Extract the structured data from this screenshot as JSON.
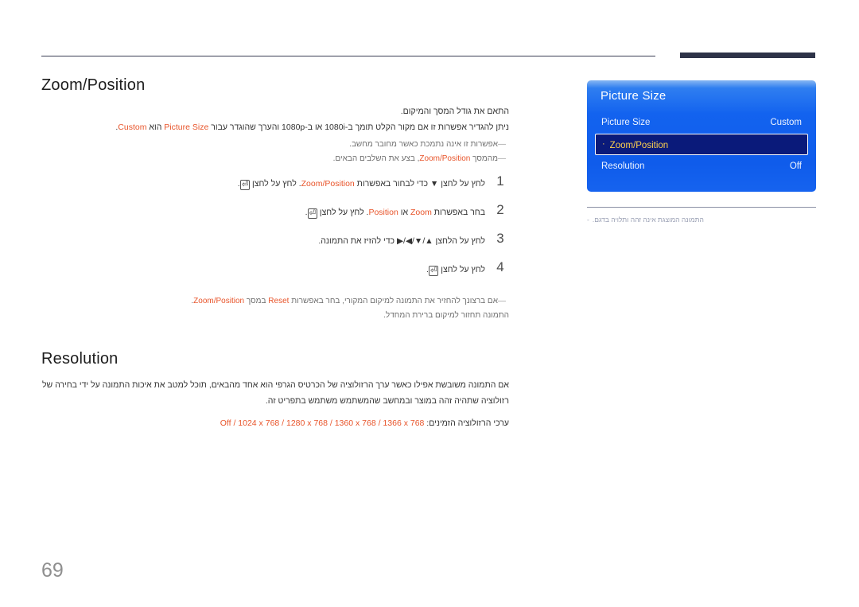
{
  "page": {
    "number": "69"
  },
  "sections": {
    "zoom_position": {
      "title": "Zoom/Position",
      "lead": "התאם את גודל המסך והמיקום.",
      "notes": [
        {
          "before": "ניתן להגדיר אפשרות זו אם מקור הקלט תומך ב-1080i או ב-1080p והערך שהוגדר עבור ",
          "term": "Picture Size",
          "middle": " הוא ",
          "term2": "Custom",
          "after": "."
        }
      ],
      "sub_notes": [
        "אפשרות זו אינה נתמכת כאשר מחובר מחשב.",
        "מהמסך Zoom/Position, בצע את השלבים הבאים."
      ],
      "sub_note_2_parts": {
        "before": "מהמסך ",
        "term": "Zoom/Position",
        "after": ", בצע את השלבים הבאים."
      },
      "steps": [
        {
          "num": "1",
          "before": "לחץ על לחצן ▼ כדי לבחור באפשרות ",
          "term": "Zoom/Position",
          "after": ". לחץ על לחצן ",
          "key": "⏎",
          "tail": "."
        },
        {
          "num": "2",
          "before": "בחר באפשרות ",
          "term": "Zoom",
          "middle": " או ",
          "term2": "Position",
          "after": ". לחץ על לחצן ",
          "key": "⏎",
          "tail": "."
        },
        {
          "num": "3",
          "text": "לחץ על הלחצן ▲/▼/◀/▶ כדי להזיז את התמונה."
        },
        {
          "num": "4",
          "before": "לחץ על לחצן ",
          "key": "⏎",
          "tail": "."
        }
      ],
      "post_note": {
        "line1_before": "אם ברצונך להחזיר את התמונה למיקום המקורי, בחר באפשרות ",
        "line1_term": "Reset",
        "line1_middle": " במסך ",
        "line1_term2": "Zoom/Position",
        "line1_after": ".",
        "line2": "התמונה תחזור למיקום ברירת המחדל."
      }
    },
    "resolution": {
      "title": "Resolution",
      "body_line1": "אם התמונה משובשת אפילו כאשר ערך הרזולוציה של הכרטיס הגרפי הוא אחד מהבאים, תוכל למטב את איכות התמונה על ידי בחירה של",
      "body_line2": "רזולוציה שתהיה זהה במוצר ובמחשב שהמשתמש משתמש בתפריט זה.",
      "values_label": "ערכי הרזולוציה הזמינים: ",
      "values": "Off / 1024 x 768 / 1280 x 768 / 1360 x 768 / 1366 x 768"
    }
  },
  "osd": {
    "title": "Picture Size",
    "rows": [
      {
        "label": "Picture Size",
        "value": "Custom",
        "selected": false,
        "bullet": ""
      },
      {
        "label": "Zoom/Position",
        "value": "",
        "selected": true,
        "bullet": "·"
      },
      {
        "label": "Resolution",
        "value": "Off",
        "selected": false,
        "bullet": ""
      }
    ],
    "caption_dash": "-",
    "caption": "התמונה המוצגת אינה זהה ותלויה בדגם."
  },
  "colors": {
    "accent_orange": "#e8542a",
    "osd_blue": "#1363ef",
    "osd_selected_bg": "#0a1a7a",
    "osd_selected_text": "#ffd24d",
    "rule_dark": "#2e3348"
  }
}
